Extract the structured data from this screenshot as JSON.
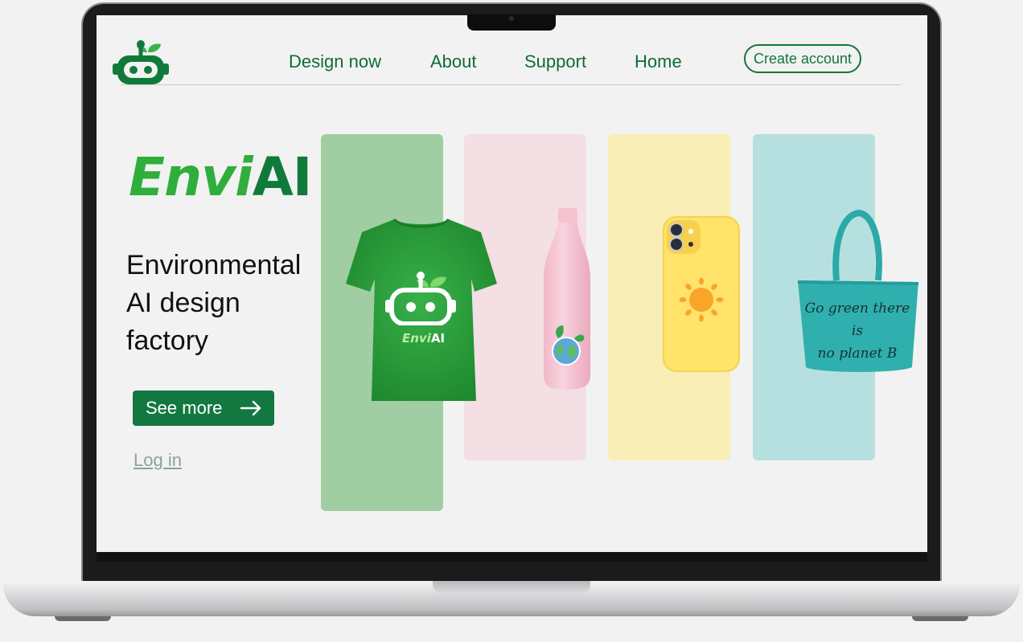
{
  "nav": {
    "links": [
      "Design now",
      "About",
      "Support",
      "Home"
    ],
    "create_account": "Create account"
  },
  "hero": {
    "brand_prefix": "Envi",
    "brand_suffix": "AI",
    "tagline_lines": [
      "Environmental",
      "AI design",
      "factory"
    ],
    "see_more": "See more",
    "log_in": "Log in"
  },
  "products": {
    "tshirt_logo_prefix": "Envi",
    "tshirt_logo_suffix": "AI",
    "bag_text_line1": "Go green there is",
    "bag_text_line2": "no planet B"
  },
  "colors": {
    "brand_green": "#137840",
    "light_green": "#2fae3c",
    "panel_green": "#a0cda2",
    "panel_pink": "#f3dfe4",
    "panel_yellow": "#f8eeb6",
    "panel_teal": "#b6e0df"
  },
  "icons": [
    "robot-logo-icon",
    "arrow-right-icon",
    "sun-icon",
    "leaf-icon"
  ]
}
